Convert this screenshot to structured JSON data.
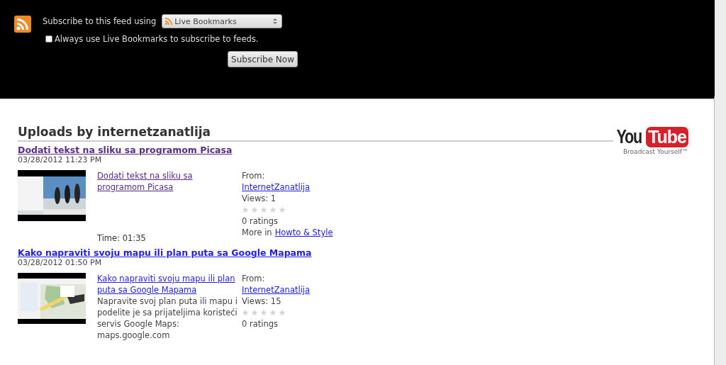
{
  "subscribe": {
    "label": "Subscribe to this feed using",
    "reader": "Live Bookmarks",
    "always_label": "Always use Live Bookmarks to subscribe to feeds.",
    "always_checked": false,
    "button": "Subscribe Now"
  },
  "feed": {
    "heading": "Uploads by internetzanatlija",
    "logo": {
      "you": "You",
      "tube": "Tube",
      "tagline": "Broadcast Yourself™"
    },
    "videos": [
      {
        "title": "Dodati tekst na sliku sa programom Picasa",
        "visited": true,
        "date": "03/28/2012 11:23 PM",
        "link": "Dodati tekst na sliku sa programom Picasa",
        "time": "Time: 01:35",
        "from": "From:",
        "author": "InternetZanatlija",
        "views": "Views: 1",
        "stars": 0,
        "ratings": "0 ratings",
        "more": "More in",
        "category": "Howto & Style"
      },
      {
        "title": "Kako napraviti svoju mapu ili plan puta sa Google Mapama",
        "visited": false,
        "date": "03/28/2012 01:50 PM",
        "link": "Kako napraviti svoju mapu ili plan puta sa Google Mapama",
        "description": "Napravite svoj plan puta ili mapu i podelite je sa prijateljima koristeći servis Google Maps: maps.google.com",
        "from": "From:",
        "author": "InternetZanatlija",
        "views": "Views: 15",
        "stars": 0,
        "ratings": "0 ratings"
      }
    ]
  }
}
